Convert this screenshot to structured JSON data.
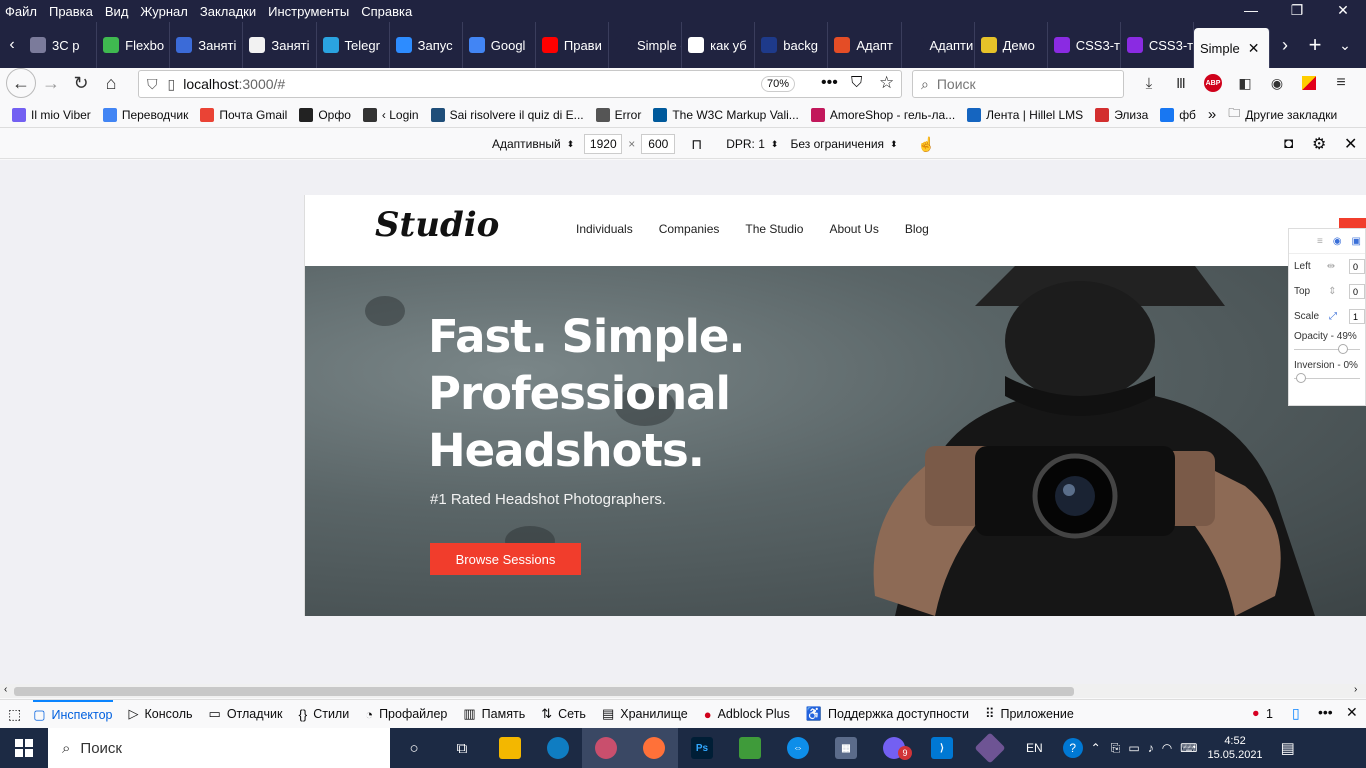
{
  "menu": [
    "Файл",
    "Правка",
    "Вид",
    "Журнал",
    "Закладки",
    "Инструменты",
    "Справка"
  ],
  "window_controls": {
    "minimize": "—",
    "maximize": "❐",
    "close": "✕"
  },
  "tabs": [
    {
      "label": "3C p",
      "color": "#7b7b9b"
    },
    {
      "label": "Flexbo",
      "color": "#3fb950"
    },
    {
      "label": "Заняті",
      "color": "#3b6bd8"
    },
    {
      "label": "Заняті",
      "color": "#f2f2f2"
    },
    {
      "label": "Telegr",
      "color": "#2aa3e0"
    },
    {
      "label": "Запус",
      "color": "#2d8cff"
    },
    {
      "label": "Googl",
      "color": "#4285f4"
    },
    {
      "label": "Прави",
      "color": "#ff0000"
    },
    {
      "label": "Simple gui",
      "color": "#202340"
    },
    {
      "label": "как уб",
      "color": "#ffffff"
    },
    {
      "label": "backg",
      "color": "#1e3a8a"
    },
    {
      "label": "Адапт",
      "color": "#e44d26"
    },
    {
      "label": "Адаптивна",
      "color": "#202340"
    },
    {
      "label": "Демо",
      "color": "#e6c229"
    },
    {
      "label": "CSS3-т",
      "color": "#8a2be2"
    },
    {
      "label": "CSS3-т",
      "color": "#8a2be2"
    }
  ],
  "active_tab": {
    "label": "Simple"
  },
  "nav": {
    "url_host": "localhost",
    "url_rest": ":3000/#",
    "zoom": "70%",
    "search_placeholder": "Поиск"
  },
  "bookmarks": [
    {
      "label": "Il mio Viber",
      "color": "#7360f2"
    },
    {
      "label": "Переводчик",
      "color": "#4285f4"
    },
    {
      "label": "Почта Gmail",
      "color": "#ea4335"
    },
    {
      "label": "Орфо",
      "color": "#222222"
    },
    {
      "label": "‹ Login",
      "color": "#333333"
    },
    {
      "label": "Sai risolvere il quiz di E...",
      "color": "#1f4e79"
    },
    {
      "label": "Error",
      "color": "#555555"
    },
    {
      "label": "The W3C Markup Vali...",
      "color": "#005a9c"
    },
    {
      "label": "AmoreShop - гель-ла...",
      "color": "#c2185b"
    },
    {
      "label": "Лента | Hillel LMS",
      "color": "#1565c0"
    },
    {
      "label": "Элиза",
      "color": "#d32f2f"
    },
    {
      "label": "фб",
      "color": "#1877f2"
    }
  ],
  "bookmarks_more": "»",
  "other_bookmarks": "Другие закладки",
  "rdm": {
    "device": "Адаптивный",
    "width": "1920",
    "times": "×",
    "height": "600",
    "dpr": "DPR: 1",
    "throttle": "Без ограничения"
  },
  "site": {
    "logo": "Studio",
    "nav": [
      "Individuals",
      "Companies",
      "The Studio",
      "About Us",
      "Blog"
    ],
    "hero_title_1": "Fast. Simple.",
    "hero_title_2": "Professional",
    "hero_title_3": "Headshots.",
    "hero_sub": "#1 Rated Headshot Photographers.",
    "hero_btn": "Browse Sessions",
    "accent": "#f13d2c"
  },
  "pixel_panel": {
    "left_label": "Left",
    "left_value": "0",
    "top_label": "Top",
    "top_value": "0",
    "scale_label": "Scale",
    "scale_value": "1",
    "opacity": "Opacity - 49%",
    "inversion": "Inversion - 0%"
  },
  "devtools": {
    "tabs": [
      "Инспектор",
      "Консоль",
      "Отладчик",
      "Стили",
      "Профайлер",
      "Память",
      "Сеть",
      "Хранилище",
      "Adblock Plus",
      "Поддержка доступности",
      "Приложение"
    ],
    "error_count": "1"
  },
  "taskbar": {
    "search": "Поиск",
    "lang": "EN",
    "time": "4:52",
    "date": "15.05.2021",
    "viber_badge": "9"
  }
}
